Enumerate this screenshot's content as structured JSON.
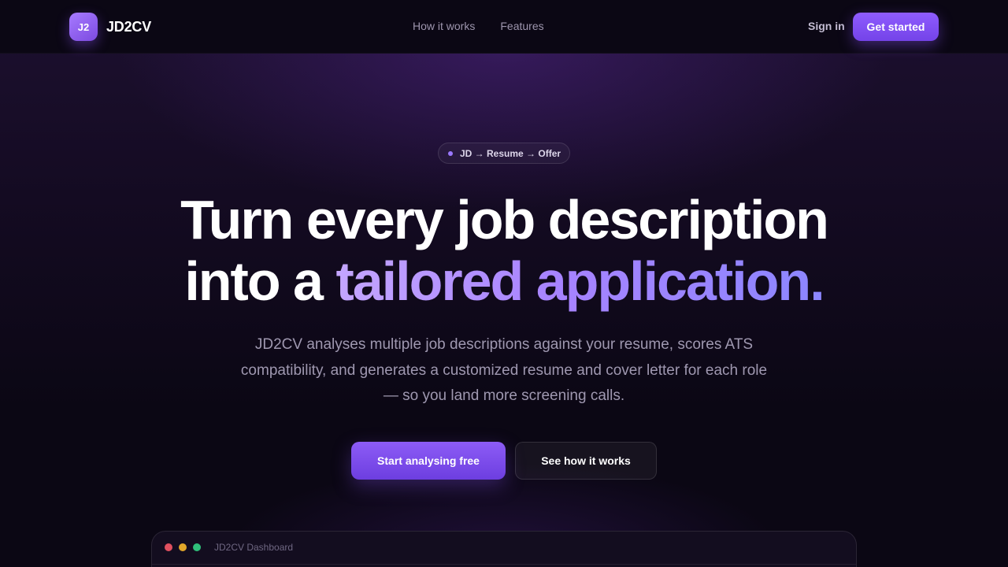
{
  "nav": {
    "logo_text": "J2",
    "brand": "JD2CV",
    "links": [
      {
        "label": "How it works"
      },
      {
        "label": "Features"
      }
    ],
    "sign_in": "Sign in",
    "get_started": "Get started"
  },
  "hero": {
    "pill": "JD → Resume → Offer",
    "headline_line1": "Turn every job description",
    "headline_line2_plain": "into a ",
    "headline_line2_accent": "tailored application.",
    "subtitle": "JD2CV analyses multiple job descriptions against your resume, scores ATS compatibility, and generates a customized resume and cover letter for each role — so you land more screening calls.",
    "primary_cta": "Start analysing free",
    "secondary_cta": "See how it works"
  },
  "dashboard": {
    "title": "JD2CV Dashboard"
  },
  "colors": {
    "accent": "#8b5cf6",
    "accent_light": "#c4a6ff",
    "background": "#0b0714",
    "traffic_red": "#e0505f",
    "traffic_yellow": "#e2a72a",
    "traffic_green": "#2fbf7a"
  }
}
